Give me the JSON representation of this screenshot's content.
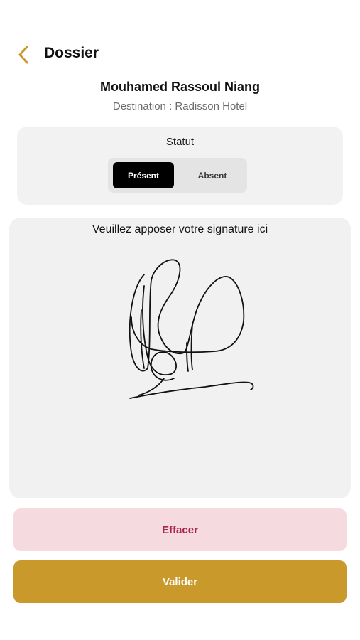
{
  "header": {
    "back_icon": "chevron-left-icon",
    "title": "Dossier"
  },
  "passenger": {
    "name": "Mouhamed Rassoul Niang",
    "destination": "Destination : Radisson Hotel"
  },
  "status": {
    "label": "Statut",
    "options": [
      "Présent",
      "Absent"
    ],
    "selected": "Présent"
  },
  "signature": {
    "prompt": "Veuillez apposer votre signature ici"
  },
  "actions": {
    "clear_label": "Effacer",
    "submit_label": "Valider"
  },
  "colors": {
    "accent": "#c9992b",
    "clear_bg": "#f5dbe0",
    "clear_text": "#a8244a",
    "selected_segment": "#000000"
  }
}
